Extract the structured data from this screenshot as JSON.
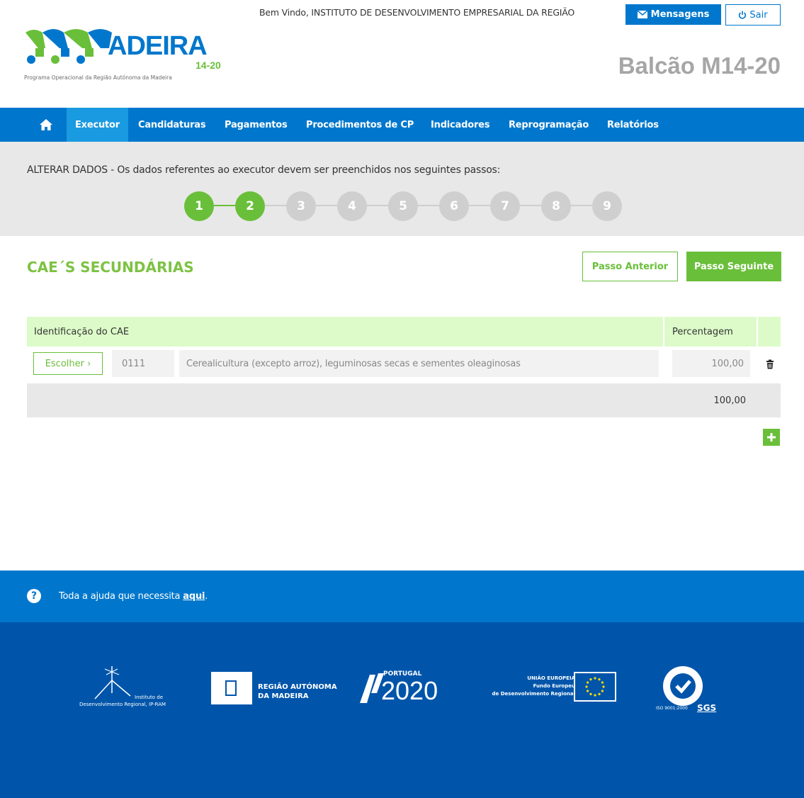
{
  "header": {
    "welcome": "Bem Vindo, INSTITUTO DE DESENVOLVIMENTO EMPRESARIAL DA REGIÃO",
    "messages_label": "Mensagens",
    "logout_label": "Sair",
    "logo_text": "ADEIRA",
    "logo_period": "14-20",
    "logo_subtitle": "Programa Operacional da Região Autónoma da Madeira",
    "portal_title": "Balcão M14-20"
  },
  "nav": {
    "items": [
      {
        "label": "Executor",
        "active": true
      },
      {
        "label": "Candidaturas"
      },
      {
        "label": "Pagamentos"
      },
      {
        "label": "Procedimentos de CP"
      },
      {
        "label": "Indicadores"
      },
      {
        "label": "Reprogramação"
      },
      {
        "label": "Relatórios"
      }
    ]
  },
  "steps": {
    "title_strong": "ALTERAR DADOS",
    "title_rest": " - Os dados referentes ao executor devem ser preenchidos nos seguintes passos:",
    "items": [
      "1",
      "2",
      "3",
      "4",
      "5",
      "6",
      "7",
      "8",
      "9"
    ],
    "completed_count": 2
  },
  "section": {
    "title": "CAE´S SECUNDÁRIAS",
    "prev_label": "Passo Anterior",
    "next_label": "Passo Seguinte"
  },
  "table": {
    "headers": {
      "cae": "Identificação do CAE",
      "percent": "Percentagem"
    },
    "rows": [
      {
        "choose_label": "Escolher ›",
        "code": "0111",
        "description": "Cerealicultura (excepto arroz), leguminosas secas e sementes oleaginosas",
        "percent": "100,00"
      }
    ],
    "total": "100,00"
  },
  "help": {
    "text": "Toda a ajuda que necessita ",
    "link": "aqui",
    "end": "."
  },
  "footer_logos": {
    "idr_line1": "Instituto de",
    "idr_line2": "Desenvolvimento Regional, IP-RAM",
    "ram_line1": "REGIÃO AUTÓNOMA",
    "ram_line2": "DA MADEIRA",
    "p2020_small": "PORTUGAL",
    "p2020_big": "2020",
    "ue_line1": "UNIÃO EUROPEIA",
    "ue_line2": "Fundo Europeu",
    "ue_line3": "de Desenvolvimento Regional",
    "sgs_iso": "ISO 9001:2000",
    "sgs_label": "SGS"
  },
  "colors": {
    "brand_blue": "#0077cc",
    "brand_green": "#6abf3a",
    "footer_blue": "#0055aa"
  }
}
